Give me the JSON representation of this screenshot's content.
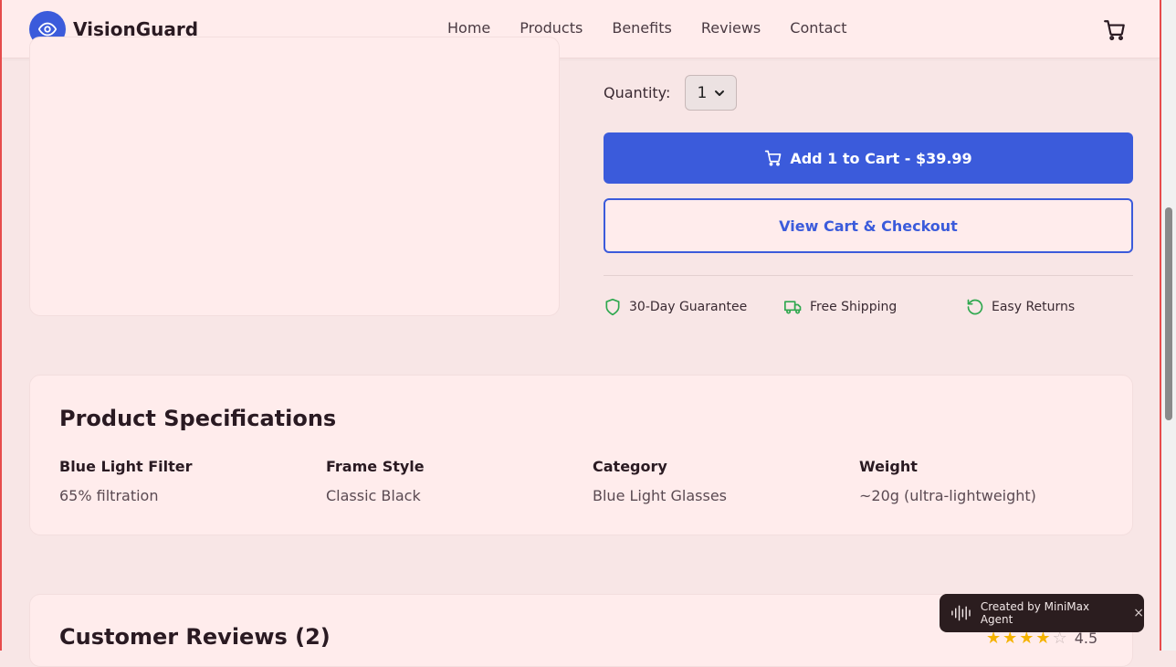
{
  "header": {
    "brand": "VisionGuard",
    "nav": [
      "Home",
      "Products",
      "Benefits",
      "Reviews",
      "Contact"
    ]
  },
  "purchase": {
    "quantity_label": "Quantity:",
    "quantity_value": "1",
    "add_to_cart": "Add 1 to Cart - $39.99",
    "view_cart": "View Cart & Checkout",
    "perks": [
      "30-Day Guarantee",
      "Free Shipping",
      "Easy Returns"
    ]
  },
  "specs": {
    "title": "Product Specifications",
    "items": [
      {
        "label": "Blue Light Filter",
        "value": "65% filtration"
      },
      {
        "label": "Frame Style",
        "value": "Classic Black"
      },
      {
        "label": "Category",
        "value": "Blue Light Glasses"
      },
      {
        "label": "Weight",
        "value": "~20g (ultra-lightweight)"
      }
    ]
  },
  "reviews": {
    "title": "Customer Reviews (2)",
    "rating": 4.5,
    "rating_text": "4.5"
  },
  "badge": {
    "text": "Created by MiniMax Agent",
    "close": "×"
  },
  "colors": {
    "primary": "#3b5bdb",
    "background": "#f8e6e6",
    "card": "#ffecec",
    "perk_icon": "#2fa84f",
    "star": "#f5b301"
  },
  "icons": {
    "logo": "eye-icon",
    "cart": "cart-icon",
    "perks": [
      "shield-icon",
      "truck-icon",
      "refresh-icon"
    ],
    "badge": "waveform-icon"
  }
}
